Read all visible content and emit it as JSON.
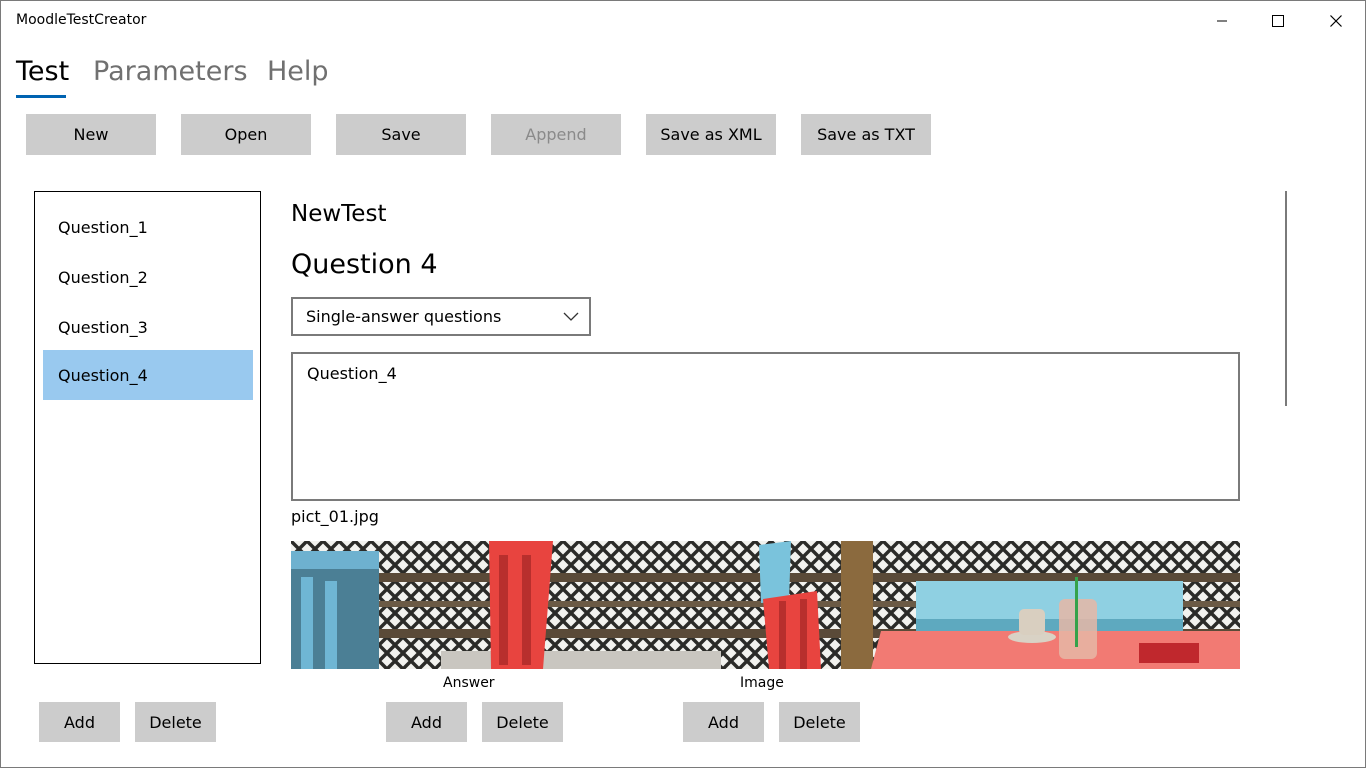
{
  "window": {
    "title": "MoodleTestCreator"
  },
  "tabs": [
    {
      "label": "Test",
      "selected": true
    },
    {
      "label": "Parameters"
    },
    {
      "label": "Help"
    }
  ],
  "toolbar": {
    "new_label": "New",
    "open_label": "Open",
    "save_label": "Save",
    "append_label": "Append",
    "save_xml_label": "Save as XML",
    "save_txt_label": "Save as TXT"
  },
  "questions": {
    "items": [
      "Question_1",
      "Question_2",
      "Question_3",
      "Question_4"
    ],
    "selected_index": 3,
    "add_label": "Add",
    "delete_label": "Delete"
  },
  "editor": {
    "test_name": "NewTest",
    "question_title": "Question 4",
    "question_type": "Single-answer questions",
    "question_text": "Question_4",
    "image_filename": "pict_01.jpg"
  },
  "answer_group": {
    "label": "Answer",
    "add_label": "Add",
    "delete_label": "Delete"
  },
  "image_group": {
    "label": "Image",
    "add_label": "Add",
    "delete_label": "Delete"
  },
  "colors": {
    "accent": "#0063b1",
    "selection": "#99c9ef",
    "button": "#cccccc"
  }
}
